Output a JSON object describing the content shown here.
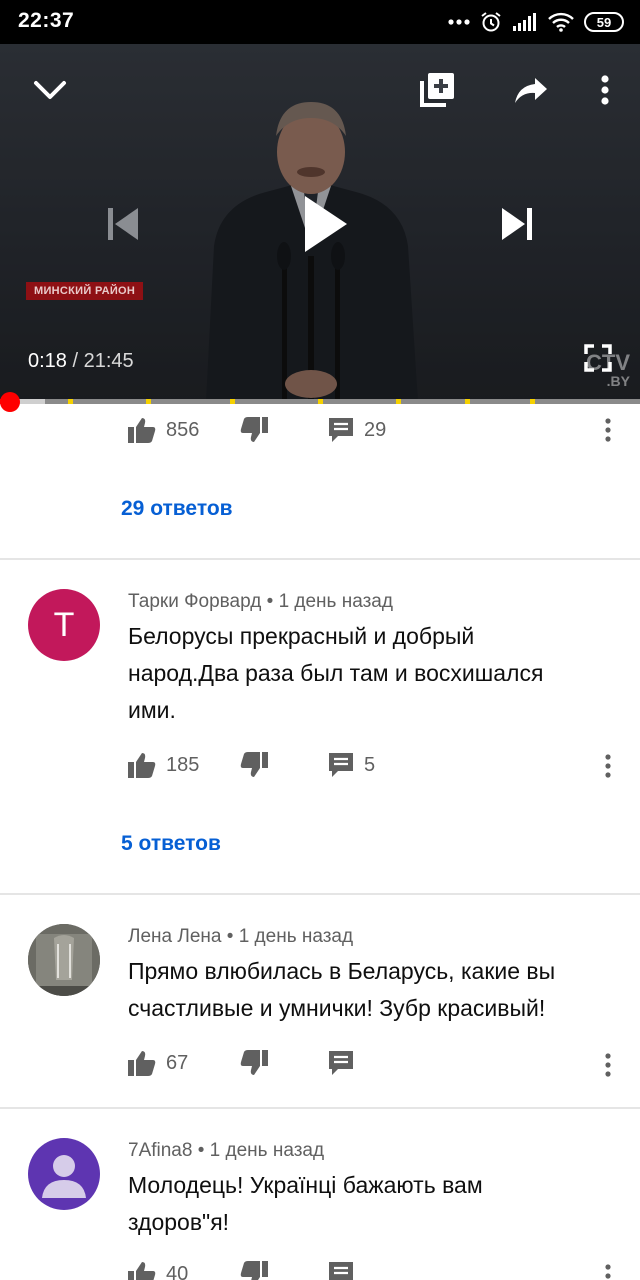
{
  "status_bar": {
    "time": "22:37",
    "battery": "59",
    "icons": [
      "more-dots-icon",
      "alarm-icon",
      "signal-icon",
      "wifi-icon",
      "battery-icon"
    ]
  },
  "player": {
    "lower_third": "МИНСКИЙ РАЙОН",
    "current_time": "0:18",
    "separator": " / ",
    "duration": "21:45",
    "watermark": "CTV",
    "watermark_sub": ".BY",
    "controls": [
      "collapse-icon",
      "add-to-playlist-icon",
      "share-icon",
      "more-vert-icon",
      "previous-icon",
      "play-icon",
      "next-icon",
      "fullscreen-icon"
    ],
    "progress_fraction": 0.014,
    "buffer_fraction": 0.07,
    "colors": {
      "progress": "#ff0000",
      "chapter_markers": "#f5d100"
    }
  },
  "comments": [
    {
      "likes": "856",
      "reply_count": "29",
      "replies_link": "29 ответов"
    },
    {
      "author": "Тарки Форвард",
      "time": "1 день назад",
      "avatar_letter": "Т",
      "avatar_color": "#c2185b",
      "text_line1": "Белорусы прекрасный и добрый",
      "text_line2": "народ.Два раза  был там и восхишался",
      "text_line3": "ими.",
      "likes": "185",
      "reply_count": "5",
      "replies_link": "5 ответов"
    },
    {
      "author": "Лена Лена",
      "time": "1 день назад",
      "text_line1": "Прямо влюбилась в Беларусь, какие вы",
      "text_line2": "счастливые и умнички! Зубр красивый!",
      "likes": "67"
    },
    {
      "author": "7Afina8",
      "time": "1 день назад",
      "avatar_color": "#5e35b1",
      "text_line1": "Молодець! Українці бажають вам",
      "text_line2": "здоров\"я!",
      "likes": "40"
    }
  ],
  "meta_separator": " • "
}
